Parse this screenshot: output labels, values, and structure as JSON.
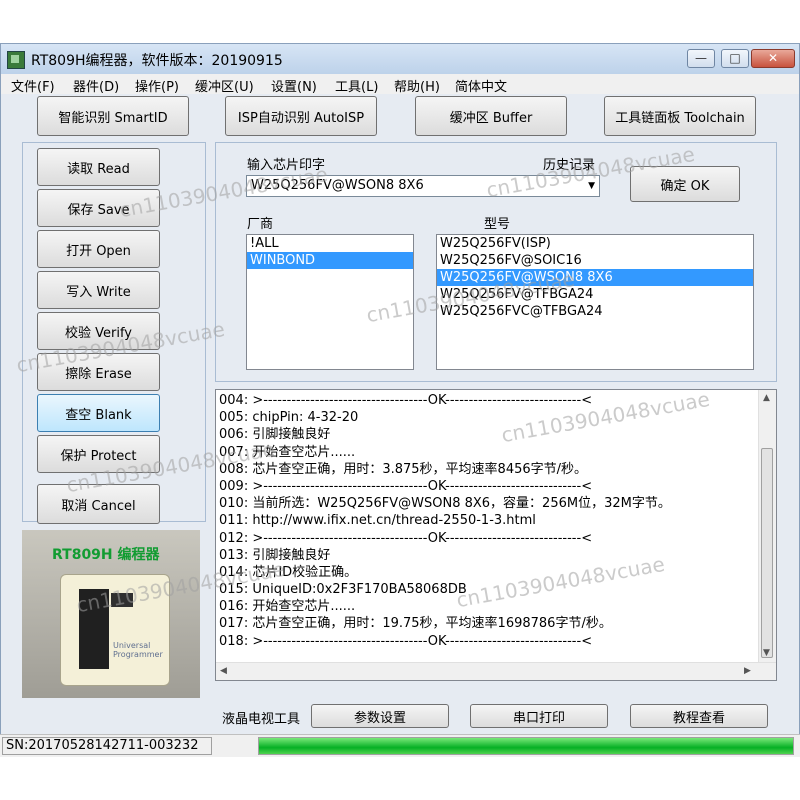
{
  "window": {
    "title": "RT809H编程器，软件版本：20190915"
  },
  "menu": [
    "文件(F)",
    "器件(D)",
    "操作(P)",
    "缓冲区(U)",
    "设置(N)",
    "工具(L)",
    "帮助(H)",
    "简体中文"
  ],
  "top_buttons": [
    "智能识别 SmartID",
    "ISP自动识别 AutoISP",
    "缓冲区 Buffer",
    "工具链面板 Toolchain"
  ],
  "side_buttons": [
    "读取 Read",
    "保存 Save",
    "打开 Open",
    "写入 Write",
    "校验 Verify",
    "擦除 Erase",
    "查空 Blank",
    "保护 Protect"
  ],
  "cancel_button": "取消 Cancel",
  "chip": {
    "input_label": "输入芯片印字",
    "history_label": "历史记录",
    "combo_value": "W25Q256FV@WSON8 8X6",
    "select_button": "确定 OK",
    "vendor_label": "厂商",
    "model_label": "型号",
    "vendors": [
      "!ALL",
      "WINBOND"
    ],
    "selected_vendor_index": 1,
    "models": [
      "W25Q256FV(ISP)",
      "W25Q256FV@SOIC16",
      "W25Q256FV@WSON8 8X6",
      "W25Q256FV@TFBGA24",
      "W25Q256FVC@TFBGA24"
    ],
    "selected_model_index": 2
  },
  "log": [
    "004: >-----------------------------------OK-----------------------------<",
    "005: chipPin: 4-32-20",
    "006: 引脚接触良好",
    "007: 开始查空芯片......",
    "008: 芯片查空正确，用时：3.875秒，平均速率8456字节/秒。",
    "009: >-----------------------------------OK-----------------------------<",
    "010: 当前所选：W25Q256FV@WSON8 8X6，容量：256M位，32M字节。",
    "011: http://www.ifix.net.cn/thread-2550-1-3.html",
    "012: >-----------------------------------OK-----------------------------<",
    "013: 引脚接触良好",
    "014: 芯片ID校验正确。",
    "015: UniqueID:0x2F3F170BA58068DB",
    "016: 开始查空芯片......",
    "017: 芯片查空正确，用时：19.75秒，平均速率1698786字节/秒。",
    "018: >-----------------------------------OK-----------------------------<"
  ],
  "bottom_tools": {
    "label": "液晶电视工具",
    "buttons": [
      "参数设置",
      "串口打印",
      "教程查看"
    ]
  },
  "product": {
    "title": "RT809H 编程器",
    "device_text": "Universal Programmer"
  },
  "status": {
    "sn": "SN:20170528142711-003232",
    "progress": 1.0
  },
  "watermark": "cn1103904048vcuae"
}
